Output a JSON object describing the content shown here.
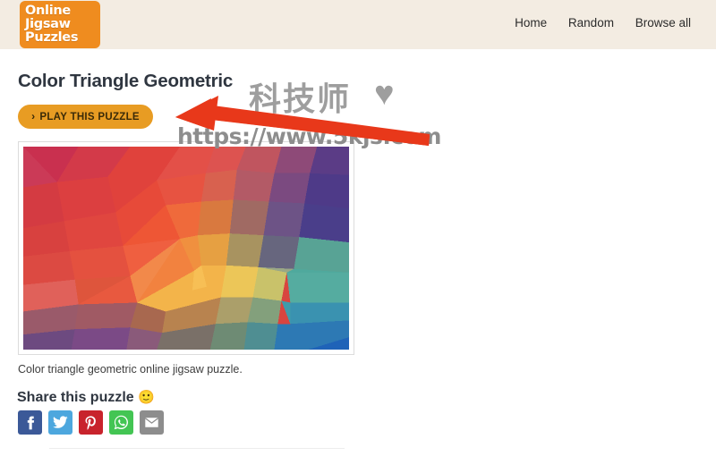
{
  "header": {
    "logo": {
      "name": "online-jigsaw-puzzles-logo",
      "line1": "Online",
      "line2": "Jigsaw",
      "line3": "Puzzles",
      "background": "#ef8c1f",
      "text_color": "#ffffff"
    },
    "background": "#f3ece2",
    "nav": [
      {
        "label": "Home",
        "name": "nav-link-home"
      },
      {
        "label": "Random",
        "name": "nav-link-random"
      },
      {
        "label": "Browse all",
        "name": "nav-link-browse-all"
      }
    ]
  },
  "main": {
    "title": "Color Triangle Geometric",
    "play_button": {
      "label": "PLAY THIS PUZZLE",
      "chevron": "›",
      "background": "#e89c23",
      "text_color": "#3a2a08"
    },
    "puzzle_image": {
      "alt": "Color triangle geometric low-poly mosaic",
      "caption": "Color triangle geometric online jigsaw puzzle."
    },
    "share": {
      "heading": "Share this puzzle",
      "emoji": "🙂",
      "buttons": [
        {
          "label": "Facebook",
          "name": "share-facebook-button",
          "color": "#3b5998"
        },
        {
          "label": "Twitter",
          "name": "share-twitter-button",
          "color": "#4da7de"
        },
        {
          "label": "Pinterest",
          "name": "share-pinterest-button",
          "color": "#c8232c"
        },
        {
          "label": "WhatsApp",
          "name": "share-whatsapp-button",
          "color": "#43c553"
        },
        {
          "label": "Email",
          "name": "share-email-button",
          "color": "#8d8d8d"
        }
      ]
    }
  },
  "watermark": {
    "cjk_text": "科技师",
    "heart": "♥",
    "url": "https://www.5kjs.com",
    "color": "#9e9e9e",
    "arrow_color": "#e8381a"
  }
}
